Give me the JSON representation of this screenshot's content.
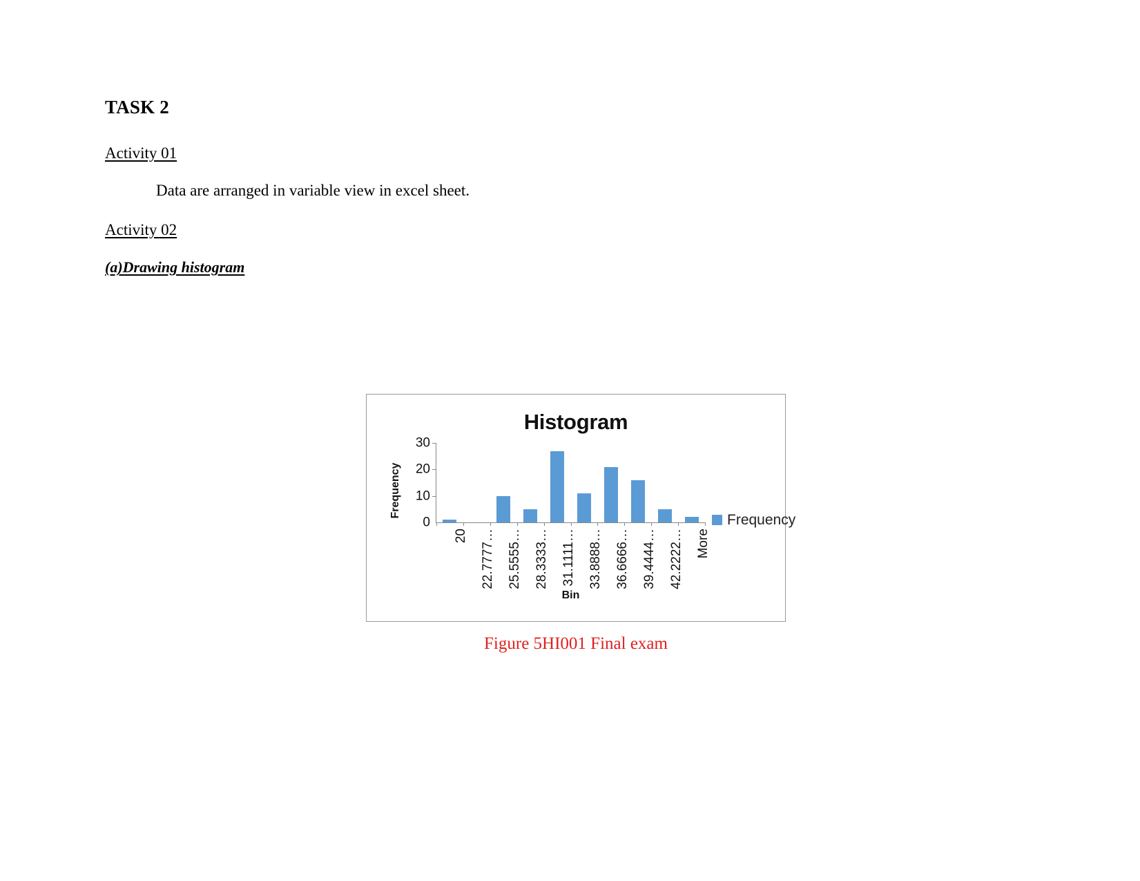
{
  "document": {
    "task_title": "TASK 2",
    "activity_01_label": "Activity 01",
    "activity_01_text": "Data are arranged in variable view in excel sheet.",
    "activity_02_label": "Activity 02",
    "subheading_a": "(a)Drawing histogram",
    "figure_caption": "Figure 5HI001 Final exam",
    "caption_color": "#e02020"
  },
  "chart_data": {
    "type": "bar",
    "title": "Histogram",
    "xlabel": "Bin",
    "ylabel": "Frequency",
    "categories": [
      "20",
      "22.7777…",
      "25.5555…",
      "28.3333…",
      "31.1111…",
      "33.8888…",
      "36.6666…",
      "39.4444…",
      "42.2222…",
      "More"
    ],
    "values": [
      1,
      0,
      10,
      5,
      27,
      11,
      21,
      16,
      5,
      2
    ],
    "series": [
      {
        "name": "Frequency",
        "values": [
          1,
          0,
          10,
          5,
          27,
          11,
          21,
          16,
          5,
          2
        ],
        "color": "#5b9bd5"
      }
    ],
    "ylim": [
      0,
      30
    ],
    "yticks": [
      0,
      10,
      20,
      30
    ],
    "ytick_labels": [
      "0",
      "10",
      "20",
      "30"
    ],
    "grid": false,
    "legend": {
      "position": "right",
      "entries": [
        "Frequency"
      ]
    }
  }
}
